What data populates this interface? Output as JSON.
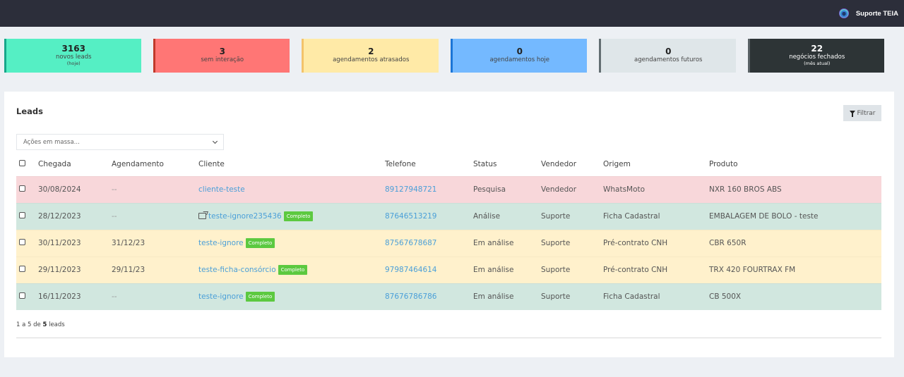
{
  "topbar": {
    "user_name": "Suporte TEIA"
  },
  "cards": [
    {
      "value": "3163",
      "label": "novos leads",
      "sub": "(hoje)",
      "color": "#55efc4"
    },
    {
      "value": "3",
      "label": "sem interação",
      "sub": "",
      "color": "#ff7675"
    },
    {
      "value": "2",
      "label": "agendamentos atrasados",
      "sub": "",
      "color": "#ffeaa7"
    },
    {
      "value": "0",
      "label": "agendamentos hoje",
      "sub": "",
      "color": "#74b9ff"
    },
    {
      "value": "0",
      "label": "agendamentos futuros",
      "sub": "",
      "color": "#dfe6e9"
    },
    {
      "value": "22",
      "label": "negócios fechados",
      "sub": "(mês atual)",
      "color": "#2d3436"
    }
  ],
  "leads": {
    "title": "Leads",
    "filter_label": "Filtrar",
    "bulk_actions_placeholder": "Ações em massa...",
    "columns": [
      "Chegada",
      "Agendamento",
      "Cliente",
      "Telefone",
      "Status",
      "Vendedor",
      "Origem",
      "Produto"
    ],
    "rows": [
      {
        "chegada": "30/08/2024",
        "agendamento": "--",
        "cliente": "cliente-teste",
        "badge": "",
        "shared": false,
        "telefone": "89127948721",
        "status": "Pesquisa",
        "vendedor": "Vendedor",
        "origem": "WhatsMoto",
        "produto": "NXR 160 BROS ABS",
        "row_color": "#f8d7da"
      },
      {
        "chegada": "28/12/2023",
        "agendamento": "--",
        "cliente": "teste-ignore235436",
        "badge": "Completo",
        "shared": true,
        "telefone": "87646513219",
        "status": "Análise",
        "vendedor": "Suporte",
        "origem": "Ficha Cadastral",
        "produto": "EMBALAGEM DE BOLO - teste",
        "row_color": "#d1e7df"
      },
      {
        "chegada": "30/11/2023",
        "agendamento": "31/12/23",
        "cliente": "teste-ignore",
        "badge": "Completo",
        "shared": false,
        "telefone": "87567678687",
        "status": "Em análise",
        "vendedor": "Suporte",
        "origem": "Pré-contrato CNH",
        "produto": "CBR 650R",
        "row_color": "#fff1cc"
      },
      {
        "chegada": "29/11/2023",
        "agendamento": "29/11/23",
        "cliente": "teste-ficha-consórcio",
        "badge": "Completo",
        "shared": false,
        "telefone": "97987464614",
        "status": "Em análise",
        "vendedor": "Suporte",
        "origem": "Pré-contrato CNH",
        "produto": "TRX 420 FOURTRAX FM",
        "row_color": "#fff1cc"
      },
      {
        "chegada": "16/11/2023",
        "agendamento": "--",
        "cliente": "teste-ignore",
        "badge": "Completo",
        "shared": false,
        "telefone": "87676786786",
        "status": "Em análise",
        "vendedor": "Suporte",
        "origem": "Ficha Cadastral",
        "produto": "CB 500X",
        "row_color": "#d1e7df"
      }
    ],
    "pagination": {
      "prefix": "1 a 5 de",
      "total": "5",
      "suffix": "leads"
    }
  }
}
